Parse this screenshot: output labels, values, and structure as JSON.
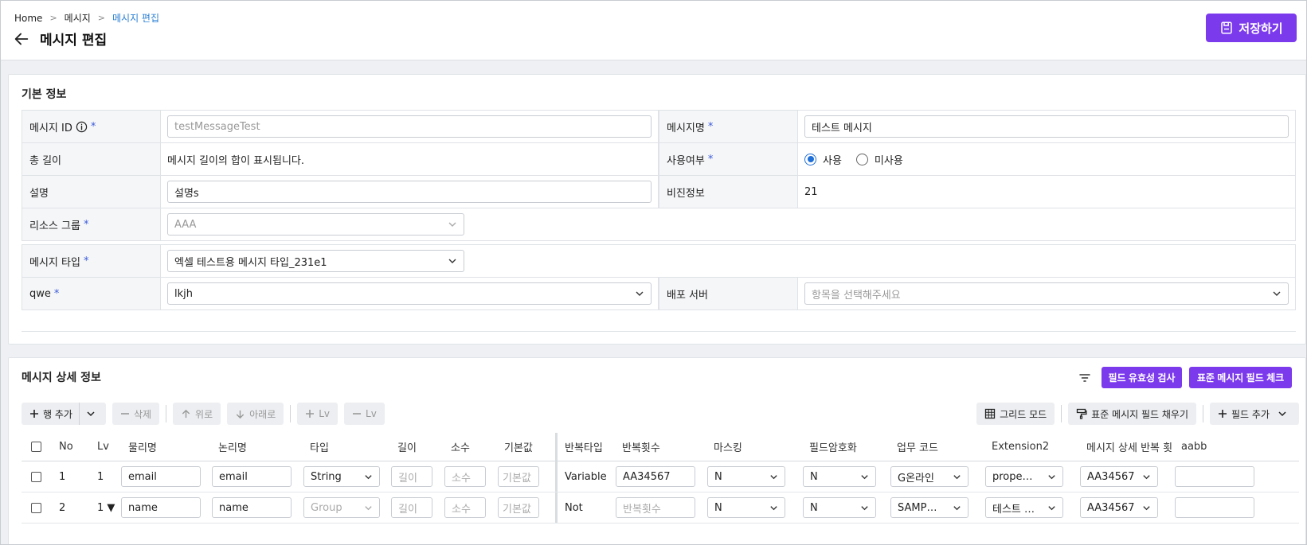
{
  "breadcrumb": {
    "home": "Home",
    "parent": "메시지",
    "current": "메시지 편집"
  },
  "page": {
    "title": "메시지 편집",
    "save_label": "저장하기"
  },
  "basic": {
    "section_title": "기본 정보",
    "message_id": {
      "label": "메시지 ID",
      "placeholder": "testMessageTest"
    },
    "message_name": {
      "label": "메시지명",
      "value": "테스트 메시지"
    },
    "total_length": {
      "label": "총 길이",
      "value": "메시지 길이의 합이 표시됩니다."
    },
    "use_flag": {
      "label": "사용여부",
      "options": [
        "사용",
        "미사용"
      ],
      "selected": "사용"
    },
    "description": {
      "label": "설명",
      "value": "설명s"
    },
    "version": {
      "label": "비진정보",
      "value": "21"
    },
    "resource_group": {
      "label": "리소스 그룹",
      "value": "AAA"
    },
    "message_type": {
      "label": "메시지 타입",
      "value": "엑셀 테스트용 메시지 타입_231e1"
    },
    "qwe": {
      "label": "qwe",
      "value": "lkjh"
    },
    "deploy_server": {
      "label": "배포 서버",
      "placeholder": "항목을 선택해주세요"
    }
  },
  "detail": {
    "section_title": "메시지 상세 정보",
    "validate_label": "필드 유효성 검사",
    "std_check_label": "표준 메시지 필드 체크",
    "toolbar": {
      "add_row": "행 추가",
      "delete": "삭제",
      "up": "위로",
      "down": "아래로",
      "lv_plus": "Lv",
      "lv_minus": "Lv",
      "grid_mode": "그리드 모드",
      "std_fill": "표준 메시지 필드 채우기",
      "add_field": "필드 추가"
    },
    "columns": [
      "No",
      "Lv",
      "물리명",
      "논리명",
      "타입",
      "길이",
      "소수",
      "기본값",
      "반복타입",
      "반복횟수",
      "마스킹",
      "필드암호화",
      "업무 코드",
      "Extension2",
      "메시지 상세 반복 횟",
      "aabb"
    ],
    "placeholders": {
      "length": "길이",
      "decimal": "소수",
      "default": "기본값",
      "repeat_count": "반복횟수"
    },
    "rows": [
      {
        "no": "1",
        "lv": "1",
        "physical": "email",
        "logical": "email",
        "type": "String",
        "repeat_type": "Variable",
        "repeat_count": "AA34567",
        "masking": "N",
        "encrypt": "N",
        "biz_code": "G온라인",
        "ext2": "prope…",
        "detail_repeat": "AA34567"
      },
      {
        "no": "2",
        "lv": "1 ▼",
        "physical": "name",
        "logical": "name",
        "type": "Group",
        "repeat_type": "Not",
        "repeat_count": "",
        "masking": "N",
        "encrypt": "N",
        "biz_code": "SAMP…",
        "ext2": "테스트 …",
        "detail_repeat": "AA34567"
      }
    ]
  },
  "colors": {
    "accent": "#7c3aed",
    "link": "#2a7fd4",
    "required": "#3b5bdb"
  }
}
